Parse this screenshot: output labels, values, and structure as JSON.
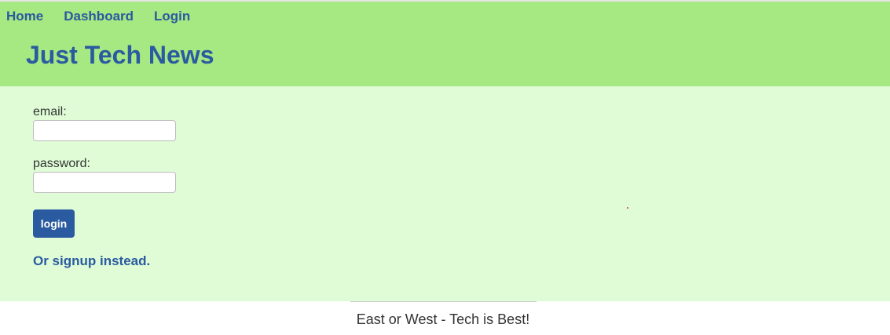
{
  "nav": {
    "home": "Home",
    "dashboard": "Dashboard",
    "login": "Login"
  },
  "header": {
    "title": "Just Tech News"
  },
  "form": {
    "email_label": "email:",
    "email_value": "",
    "password_label": "password:",
    "password_value": "",
    "login_button": "login",
    "signup_link": "Or signup instead."
  },
  "footer": {
    "text": "East or West - Tech is Best!"
  },
  "colors": {
    "header_bg": "#a6e882",
    "main_bg": "#dffcd6",
    "accent": "#2a5aa0"
  }
}
